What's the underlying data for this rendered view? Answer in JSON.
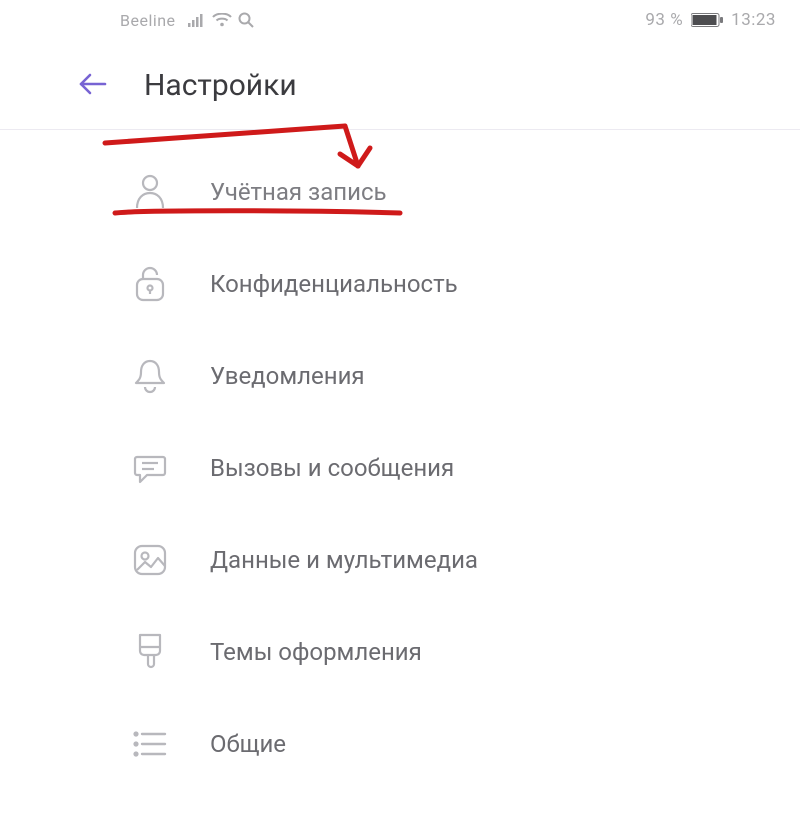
{
  "statusbar": {
    "carrier": "Beeline",
    "battery_pct": "93 %",
    "time": "13:23"
  },
  "header": {
    "title": "Настройки"
  },
  "menu": {
    "items": [
      {
        "icon": "person-icon",
        "label": "Учётная запись"
      },
      {
        "icon": "lock-icon",
        "label": "Конфиденциальность"
      },
      {
        "icon": "bell-icon",
        "label": "Уведомления"
      },
      {
        "icon": "chat-icon",
        "label": "Вызовы и сообщения"
      },
      {
        "icon": "media-icon",
        "label": "Данные и мультимедиа"
      },
      {
        "icon": "brush-icon",
        "label": "Темы оформления"
      },
      {
        "icon": "list-icon",
        "label": "Общие"
      }
    ]
  }
}
